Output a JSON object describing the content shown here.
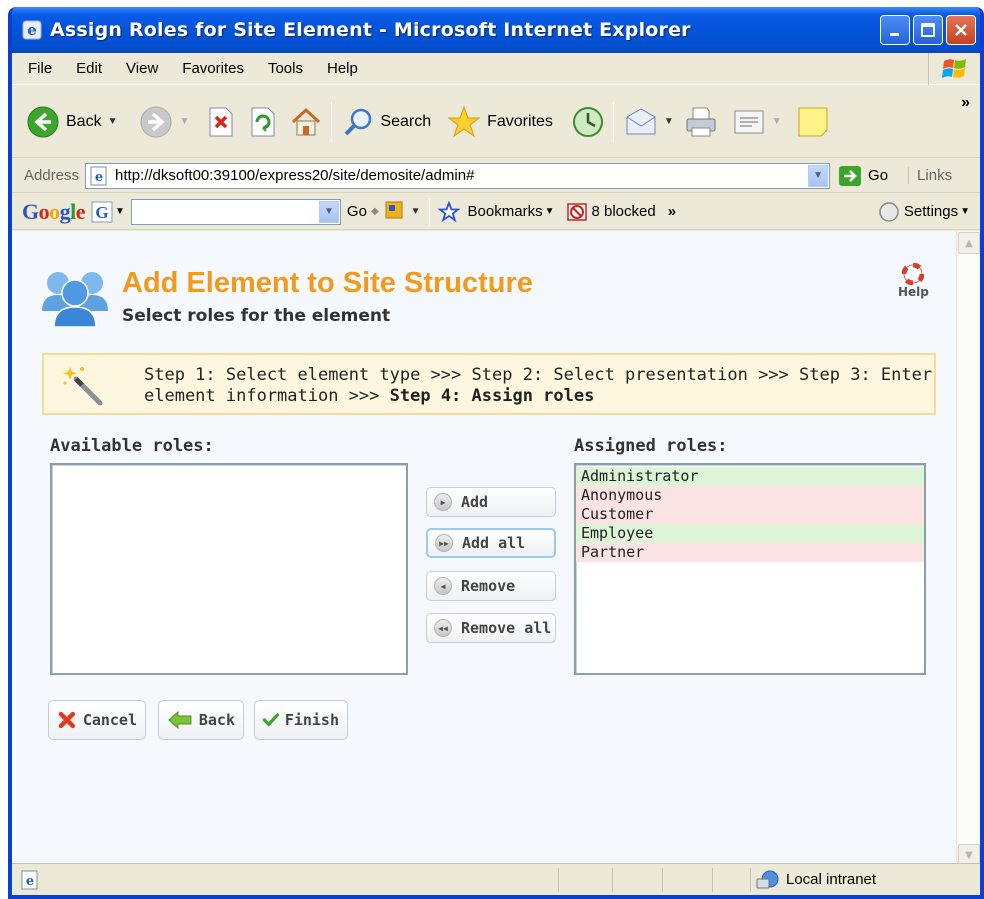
{
  "window": {
    "title": "Assign Roles for Site Element - Microsoft Internet Explorer"
  },
  "menu": [
    "File",
    "Edit",
    "View",
    "Favorites",
    "Tools",
    "Help"
  ],
  "toolbar": {
    "back": "Back",
    "search": "Search",
    "favorites": "Favorites"
  },
  "address": {
    "label": "Address",
    "url": "http://dksoft00:39100/express20/site/demosite/admin#",
    "go": "Go",
    "links": "Links"
  },
  "googlebar": {
    "logo": "Google",
    "go": "Go",
    "bookmarks": "Bookmarks",
    "blocked": "8 blocked",
    "more": "»",
    "settings": "Settings"
  },
  "page": {
    "title": "Add Element to Site Structure",
    "subtitle": "Select roles for the element",
    "help": "Help",
    "steps_prefix": "Step 1: Select element type >>> Step 2: Select presentation >>> Step 3: Enter element information >>> ",
    "steps_current": "Step 4: Assign roles",
    "available_label": "Available roles:",
    "assigned_label": "Assigned roles:",
    "available_roles": [],
    "assigned_roles": [
      {
        "name": "Administrator",
        "color": "#dcf5d6"
      },
      {
        "name": "Anonymous",
        "color": "#fbe3e3"
      },
      {
        "name": "Customer",
        "color": "#fbe3e3"
      },
      {
        "name": "Employee",
        "color": "#dcf5d6"
      },
      {
        "name": "Partner",
        "color": "#fbe3e3"
      }
    ],
    "actions": {
      "add": "Add",
      "add_all": "Add all",
      "remove": "Remove",
      "remove_all": "Remove all"
    },
    "buttons": {
      "cancel": "Cancel",
      "back": "Back",
      "finish": "Finish"
    }
  },
  "status": {
    "zone": "Local intranet"
  },
  "colors": {
    "accent": "#f39a1d",
    "titlebar": "#0454d8",
    "step_bg": "#fdf7df"
  }
}
